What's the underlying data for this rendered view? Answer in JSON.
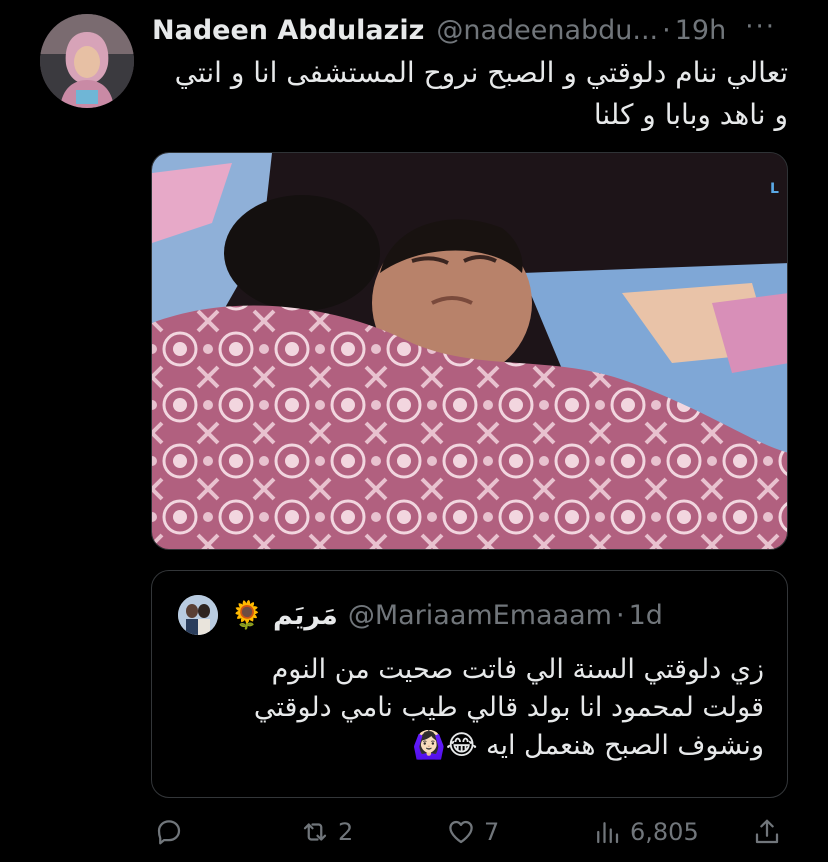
{
  "author": {
    "name": "Nadeen Abdulaziz",
    "handle": "@nadeenabdu...",
    "separator": "·",
    "time": "19h",
    "more_label": "···"
  },
  "tweet": {
    "text_line1": "تعالي ننام دلوقتي و الصبح نروح المستشفى انا و انتي",
    "text_line2": "و ناهد وبابا و كلنا"
  },
  "media": {
    "description_icon": "video-still-image"
  },
  "quoted": {
    "name": "مَريَم 🌻",
    "handle": "@MariaamEmaaam",
    "separator": "·",
    "time": "1d",
    "line1": "زي دلوقتي السنة الي فاتت صحيت من النوم",
    "line2": "قولت لمحمود انا بولد قالي طيب نامي دلوقتي",
    "line3": "ونشوف الصبح هنعمل ايه 😂🙆🏻‍♀️"
  },
  "actions": {
    "reply_icon": "reply-icon",
    "retweet_count": "2",
    "like_count": "7",
    "views_count": "6,805"
  },
  "colors": {
    "background": "#000000",
    "text": "#e7e9ea",
    "muted": "#71767b",
    "border": "#2f3336"
  }
}
